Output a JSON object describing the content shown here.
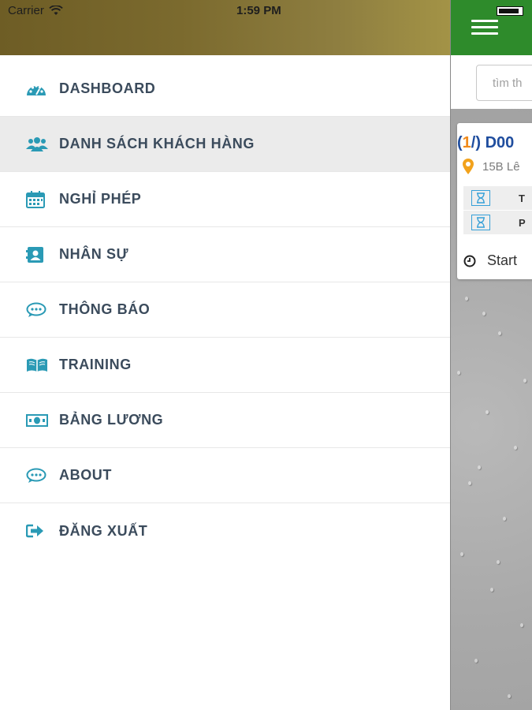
{
  "status_bar": {
    "carrier": "Carrier",
    "time": "1:59 PM"
  },
  "menu": {
    "items": [
      {
        "label": "DASHBOARD",
        "icon": "dashboard-gauge-icon"
      },
      {
        "label": "DANH SÁCH KHÁCH HÀNG",
        "icon": "users-group-icon",
        "active": true
      },
      {
        "label": "NGHỈ PHÉP",
        "icon": "calendar-icon"
      },
      {
        "label": "NHÂN SỰ",
        "icon": "contact-card-icon"
      },
      {
        "label": "THÔNG BÁO",
        "icon": "chat-bubble-icon"
      },
      {
        "label": "TRAINING",
        "icon": "open-book-icon"
      },
      {
        "label": "BẢNG LƯƠNG",
        "icon": "money-bill-icon"
      },
      {
        "label": "ABOUT",
        "icon": "chat-bubble-icon"
      },
      {
        "label": "ĐĂNG XUẤT",
        "icon": "sign-out-icon"
      }
    ]
  },
  "main": {
    "search_placeholder": "tìm th",
    "card": {
      "title_open": "(",
      "title_index": "1",
      "title_rest": "/) D00",
      "address": "15B Lê",
      "rows": [
        {
          "label": "T"
        },
        {
          "label": "P"
        }
      ],
      "start_label": "Start"
    }
  },
  "colors": {
    "accent_green": "#2e8b2b",
    "menu_text": "#3b4b5c",
    "icon_teal": "#2a9ab5",
    "card_title": "#1f4d9e",
    "card_index": "#f08a1c",
    "header_olive": "#7b6a2e"
  }
}
